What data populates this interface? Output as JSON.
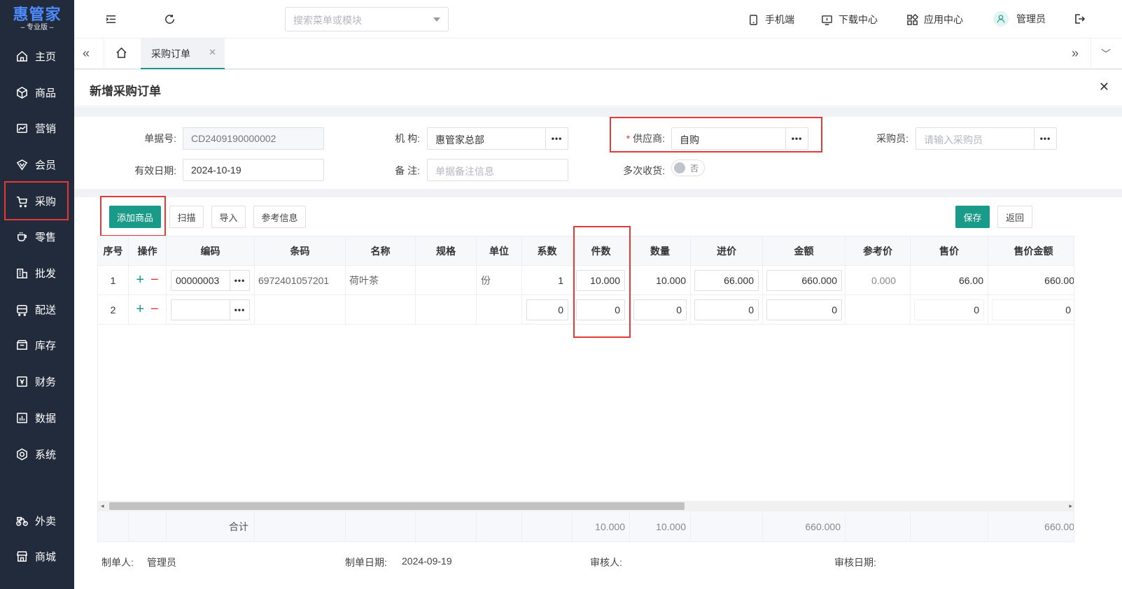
{
  "app": {
    "logo_main": "惠管家",
    "logo_sub": "专业版"
  },
  "sidebar": {
    "items": [
      {
        "label": "主页",
        "icon": "home-icon"
      },
      {
        "label": "商品",
        "icon": "box-icon"
      },
      {
        "label": "营销",
        "icon": "chart-icon"
      },
      {
        "label": "会员",
        "icon": "member-icon"
      },
      {
        "label": "采购",
        "icon": "cart-icon",
        "active": true
      },
      {
        "label": "零售",
        "icon": "cup-icon"
      },
      {
        "label": "批发",
        "icon": "building-icon"
      },
      {
        "label": "配送",
        "icon": "truck-icon"
      },
      {
        "label": "库存",
        "icon": "inventory-icon"
      },
      {
        "label": "财务",
        "icon": "finance-icon"
      },
      {
        "label": "数据",
        "icon": "data-icon"
      },
      {
        "label": "系统",
        "icon": "settings-icon"
      },
      {
        "label": "外卖",
        "icon": "bike-icon"
      },
      {
        "label": "商城",
        "icon": "store-icon"
      }
    ]
  },
  "topbar": {
    "search_placeholder": "搜索菜单或模块",
    "mobile": "手机端",
    "download": "下载中心",
    "apps": "应用中心",
    "user": "管理员"
  },
  "tabs": {
    "active": "采购订单"
  },
  "page": {
    "title": "新增采购订单"
  },
  "form": {
    "doc_no_label": "单据号:",
    "doc_no": "CD2409190000002",
    "org_label": "机 构:",
    "org": "惠管家总部",
    "supplier_label": "供应商:",
    "supplier": "自购",
    "buyer_label": "采购员:",
    "buyer_placeholder": "请输入采购员",
    "valid_date_label": "有效日期:",
    "valid_date": "2024-10-19",
    "remark_label": "备 注:",
    "remark_placeholder": "单据备注信息",
    "multi_receive_label": "多次收货:",
    "multi_receive_value": "否"
  },
  "toolbar": {
    "add": "添加商品",
    "scan": "扫描",
    "import": "导入",
    "reference": "参考信息",
    "save": "保存",
    "back": "返回"
  },
  "table": {
    "headers": [
      "序号",
      "操作",
      "编码",
      "条码",
      "名称",
      "规格",
      "单位",
      "系数",
      "件数",
      "数量",
      "进价",
      "金额",
      "参考价",
      "售价",
      "售价金额"
    ],
    "rows": [
      {
        "no": "1",
        "code": "00000003",
        "barcode": "6972401057201",
        "name": "荷叶茶",
        "spec": "",
        "unit": "份",
        "factor": "1",
        "pieces": "10.000",
        "qty": "10.000",
        "price": "66.000",
        "amount": "660.000",
        "ref_price": "0.000",
        "sale_price": "66.00",
        "sale_amount": "660.00"
      },
      {
        "no": "2",
        "code": "",
        "barcode": "",
        "name": "",
        "spec": "",
        "unit": "",
        "factor": "0",
        "pieces": "0",
        "qty": "0",
        "price": "0",
        "amount": "0",
        "ref_price": "",
        "sale_price": "0",
        "sale_amount": "0"
      }
    ],
    "total_label": "合计",
    "totals": {
      "pieces": "10.000",
      "qty": "10.000",
      "amount": "660.000",
      "sale_amount": "660.00"
    }
  },
  "footer": {
    "maker_label": "制单人:",
    "maker": "管理员",
    "make_date_label": "制单日期:",
    "make_date": "2024-09-19",
    "auditor_label": "审核人:",
    "audit_date_label": "审核日期:"
  }
}
